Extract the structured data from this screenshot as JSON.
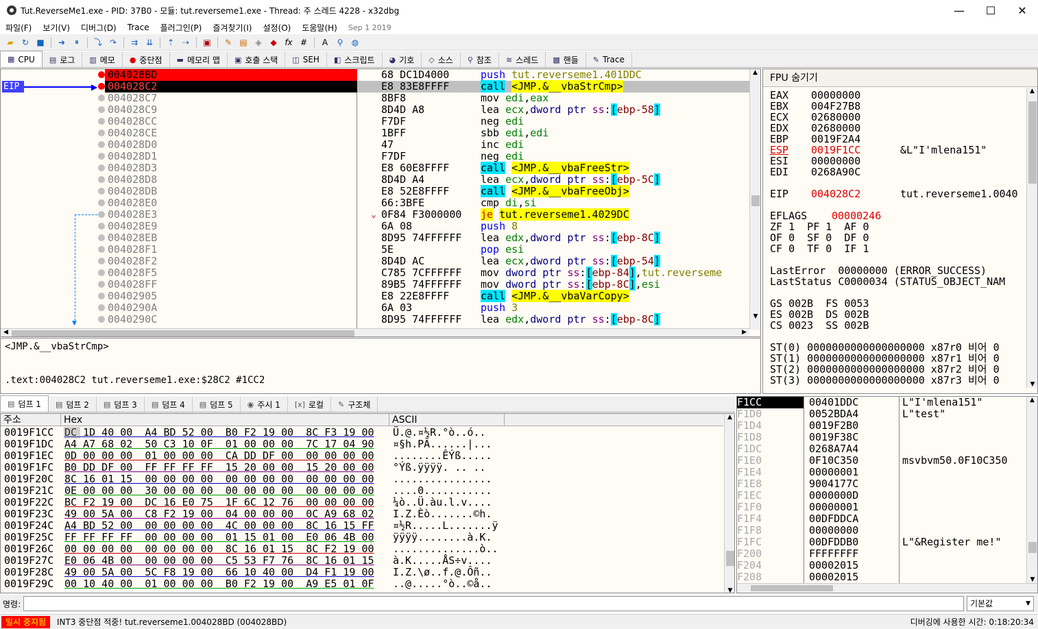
{
  "window": {
    "title": "Tut.ReverseMe1.exe - PID: 37B0 - 모듈: tut.reverseme1.exe - Thread: 주 스레드 4228 - x32dbg",
    "minimize": "—",
    "maximize": "☐",
    "close": "✕"
  },
  "menu": {
    "items": [
      "파일(F)",
      "보기(V)",
      "디버그(D)",
      "Trace",
      "플러그인(P)",
      "즐겨찾기(I)",
      "설정(O)",
      "도움말(H)"
    ],
    "date": "Sep 1 2019"
  },
  "tabs": [
    {
      "label": "CPU",
      "icon": "cpu-icon"
    },
    {
      "label": "로그",
      "icon": "log-icon"
    },
    {
      "label": "메모",
      "icon": "notes-icon"
    },
    {
      "label": "중단점",
      "icon": "breakpoint-icon"
    },
    {
      "label": "메모리 맵",
      "icon": "memory-map-icon"
    },
    {
      "label": "호출 스택",
      "icon": "call-stack-icon"
    },
    {
      "label": "SEH",
      "icon": "seh-icon"
    },
    {
      "label": "스크립트",
      "icon": "script-icon"
    },
    {
      "label": "기호",
      "icon": "symbols-icon"
    },
    {
      "label": "소스",
      "icon": "source-icon"
    },
    {
      "label": "참조",
      "icon": "references-icon"
    },
    {
      "label": "스레드",
      "icon": "threads-icon"
    },
    {
      "label": "핸들",
      "icon": "handles-icon"
    },
    {
      "label": "Trace",
      "icon": "trace-icon"
    }
  ],
  "eip_label": "EIP",
  "disasm": [
    {
      "addr": "004028BD",
      "bytes": "68 DC1D4000",
      "instr": [
        [
          "push",
          "push"
        ],
        [
          " ",
          ""
        ],
        [
          "tut.reverseme1.401DDC",
          "imm"
        ]
      ]
    },
    {
      "addr": "004028C2",
      "bytes": "E8 83E8FFFF",
      "instr": [
        [
          "call",
          "call"
        ],
        [
          " ",
          ""
        ],
        [
          "<JMP.&__vbaStrCmp>",
          "jmp"
        ]
      ]
    },
    {
      "addr": "004028C7",
      "bytes": "8BF8",
      "instr": [
        [
          "mov ",
          ""
        ],
        [
          "edi",
          "reg"
        ],
        [
          ",",
          ""
        ],
        [
          "eax",
          "reg"
        ]
      ]
    },
    {
      "addr": "004028C9",
      "bytes": "8D4D A8",
      "instr": [
        [
          "lea ",
          ""
        ],
        [
          "ecx",
          "reg"
        ],
        [
          ",",
          ""
        ],
        [
          "dword ptr ",
          "ptr"
        ],
        [
          "ss",
          "seg"
        ],
        [
          ":",
          ""
        ],
        [
          "[",
          "brk"
        ],
        [
          "ebp-58",
          "mem"
        ],
        [
          "]",
          "brk"
        ]
      ]
    },
    {
      "addr": "004028CC",
      "bytes": "F7DF",
      "instr": [
        [
          "neg ",
          ""
        ],
        [
          "edi",
          "reg"
        ]
      ]
    },
    {
      "addr": "004028CE",
      "bytes": "1BFF",
      "instr": [
        [
          "sbb ",
          ""
        ],
        [
          "edi",
          "reg"
        ],
        [
          ",",
          ""
        ],
        [
          "edi",
          "reg"
        ]
      ]
    },
    {
      "addr": "004028D0",
      "bytes": "47",
      "instr": [
        [
          "inc ",
          ""
        ],
        [
          "edi",
          "reg"
        ]
      ]
    },
    {
      "addr": "004028D1",
      "bytes": "F7DF",
      "instr": [
        [
          "neg ",
          ""
        ],
        [
          "edi",
          "reg"
        ]
      ]
    },
    {
      "addr": "004028D3",
      "bytes": "E8 60E8FFFF",
      "instr": [
        [
          "call",
          "call"
        ],
        [
          " ",
          ""
        ],
        [
          "<JMP.&__vbaFreeStr>",
          "jmp"
        ]
      ]
    },
    {
      "addr": "004028D8",
      "bytes": "8D4D A4",
      "instr": [
        [
          "lea ",
          ""
        ],
        [
          "ecx",
          "reg"
        ],
        [
          ",",
          ""
        ],
        [
          "dword ptr ",
          "ptr"
        ],
        [
          "ss",
          "seg"
        ],
        [
          ":",
          ""
        ],
        [
          "[",
          "brk"
        ],
        [
          "ebp-5C",
          "mem"
        ],
        [
          "]",
          "brk"
        ]
      ]
    },
    {
      "addr": "004028DB",
      "bytes": "E8 52E8FFFF",
      "instr": [
        [
          "call",
          "call"
        ],
        [
          " ",
          ""
        ],
        [
          "<JMP.&__vbaFreeObj>",
          "jmp"
        ]
      ]
    },
    {
      "addr": "004028E0",
      "bytes": "66:3BFE",
      "instr": [
        [
          "cmp ",
          ""
        ],
        [
          "di",
          "reg"
        ],
        [
          ",",
          ""
        ],
        [
          "si",
          "reg"
        ]
      ]
    },
    {
      "addr": "004028E3",
      "bytes": "0F84 F3000000",
      "instr": [
        [
          "je",
          "je"
        ],
        [
          " ",
          ""
        ],
        [
          "tut.reverseme1.4029DC",
          "jmp"
        ]
      ]
    },
    {
      "addr": "004028E9",
      "bytes": "6A 08",
      "instr": [
        [
          "push",
          "push"
        ],
        [
          " ",
          ""
        ],
        [
          "8",
          "imm"
        ]
      ]
    },
    {
      "addr": "004028EB",
      "bytes": "8D95 74FFFFFF",
      "instr": [
        [
          "lea ",
          ""
        ],
        [
          "edx",
          "reg"
        ],
        [
          ",",
          ""
        ],
        [
          "dword ptr ",
          "ptr"
        ],
        [
          "ss",
          "seg"
        ],
        [
          ":",
          ""
        ],
        [
          "[",
          "brk"
        ],
        [
          "ebp-8C",
          "mem"
        ],
        [
          "]",
          "brk"
        ]
      ]
    },
    {
      "addr": "004028F1",
      "bytes": "5E",
      "instr": [
        [
          "pop ",
          "push"
        ],
        [
          "esi",
          "reg"
        ]
      ]
    },
    {
      "addr": "004028F2",
      "bytes": "8D4D AC",
      "instr": [
        [
          "lea ",
          ""
        ],
        [
          "ecx",
          "reg"
        ],
        [
          ",",
          ""
        ],
        [
          "dword ptr ",
          "ptr"
        ],
        [
          "ss",
          "seg"
        ],
        [
          ":",
          ""
        ],
        [
          "[",
          "brk"
        ],
        [
          "ebp-54",
          "mem"
        ],
        [
          "]",
          "brk"
        ]
      ]
    },
    {
      "addr": "004028F5",
      "bytes": "C785 7CFFFFFF",
      "instr": [
        [
          "mov ",
          ""
        ],
        [
          "dword ptr ",
          "ptr"
        ],
        [
          "ss",
          "seg"
        ],
        [
          ":",
          ""
        ],
        [
          "[",
          "brk"
        ],
        [
          "ebp-84",
          "mem"
        ],
        [
          "]",
          "brk"
        ],
        [
          ",",
          ""
        ],
        [
          "tut.reverseme",
          "imm"
        ]
      ]
    },
    {
      "addr": "004028FF",
      "bytes": "89B5 74FFFFFF",
      "instr": [
        [
          "mov ",
          ""
        ],
        [
          "dword ptr ",
          "ptr"
        ],
        [
          "ss",
          "seg"
        ],
        [
          ":",
          ""
        ],
        [
          "[",
          "brk"
        ],
        [
          "ebp-8C",
          "mem"
        ],
        [
          "]",
          "brk"
        ],
        [
          ",",
          ""
        ],
        [
          "esi",
          "reg"
        ]
      ]
    },
    {
      "addr": "00402905",
      "bytes": "E8 22E8FFFF",
      "instr": [
        [
          "call",
          "call"
        ],
        [
          " ",
          ""
        ],
        [
          "<JMP.&__vbaVarCopy>",
          "jmp"
        ]
      ]
    },
    {
      "addr": "0040290A",
      "bytes": "6A 03",
      "instr": [
        [
          "push",
          "push"
        ],
        [
          " ",
          ""
        ],
        [
          "3",
          "imm"
        ]
      ]
    },
    {
      "addr": "0040290C",
      "bytes": "8D95 74FFFFFF",
      "instr": [
        [
          "lea ",
          ""
        ],
        [
          "edx",
          "reg"
        ],
        [
          ",",
          ""
        ],
        [
          "dword ptr ",
          "ptr"
        ],
        [
          "ss",
          "seg"
        ],
        [
          ":",
          ""
        ],
        [
          "[",
          "brk"
        ],
        [
          "ebp-8C",
          "mem"
        ],
        [
          "]",
          "brk"
        ]
      ]
    }
  ],
  "info": {
    "line1": "<JMP.&__vbaStrCmp>",
    "line2": ".text:004028C2 tut.reverseme1.exe:$28C2 #1CC2"
  },
  "regs": {
    "header": "FPU 숨기기",
    "gp": [
      {
        "name": "EAX",
        "value": "00000000",
        "comment": ""
      },
      {
        "name": "EBX",
        "value": "004F27B8",
        "comment": ""
      },
      {
        "name": "ECX",
        "value": "02680000",
        "comment": ""
      },
      {
        "name": "EDX",
        "value": "02680000",
        "comment": ""
      },
      {
        "name": "EBP",
        "value": "0019F2A4",
        "comment": ""
      },
      {
        "name": "ESP",
        "value": "0019F1CC",
        "comment": "&L\"I'mlena151\""
      },
      {
        "name": "ESI",
        "value": "00000000",
        "comment": ""
      },
      {
        "name": "EDI",
        "value": "0268A90C",
        "comment": ""
      }
    ],
    "eip": {
      "name": "EIP",
      "value": "004028C2",
      "comment": "tut.reverseme1.0040"
    },
    "eflags": {
      "name": "EFLAGS",
      "value": "00000246"
    },
    "flags": [
      "ZF 1  PF 1  AF 0",
      "OF 0  SF 0  DF 0",
      "CF 0  TF 0  IF 1"
    ],
    "lasterror": "LastError  00000000 (ERROR_SUCCESS)",
    "laststatus": "LastStatus C0000034 (STATUS_OBJECT_NAM",
    "segs": [
      "GS 002B  FS 0053",
      "ES 002B  DS 002B",
      "CS 0023  SS 002B"
    ],
    "fpu": [
      "ST(0) 0000000000000000000 x87r0 비어 0",
      "ST(1) 0000000000000000000 x87r1 비어 0",
      "ST(2) 0000000000000000000 x87r2 비어 0",
      "ST(3) 0000000000000000000 x87r3 비어 0"
    ]
  },
  "dump_tabs": [
    {
      "label": "덤프 1",
      "icon": "dump-icon"
    },
    {
      "label": "덤프 2",
      "icon": "dump-icon"
    },
    {
      "label": "덤프 3",
      "icon": "dump-icon"
    },
    {
      "label": "덤프 4",
      "icon": "dump-icon"
    },
    {
      "label": "덤프 5",
      "icon": "dump-icon"
    },
    {
      "label": "주시 1",
      "icon": "watch-icon"
    },
    {
      "label": "로컬",
      "icon": "locals-icon"
    },
    {
      "label": "구조체",
      "icon": "struct-icon"
    }
  ],
  "dump_headers": {
    "addr": "주소",
    "hex": "Hex",
    "ascii": "ASCII"
  },
  "dump": [
    {
      "a": "0019F1CC",
      "h": "DC 1D 40 00  A4 BD 52 00  B0 F2 19 00  8C F3 19 00",
      "x": "Ü.@.¤½R.°ò..ó.."
    },
    {
      "a": "0019F1DC",
      "h": "A4 A7 68 02  50 C3 10 0F  01 00 00 00  7C 17 04 90",
      "x": "¤§h.PÃ......|..."
    },
    {
      "a": "0019F1EC",
      "h": "0D 00 00 00  01 00 00 00  CA DD DF 00  00 00 00 00",
      "x": "........ÊÝß....."
    },
    {
      "a": "0019F1FC",
      "h": "B0 DD DF 00  FF FF FF FF  15 20 00 00  15 20 00 00",
      "x": "°Ýß.ÿÿÿÿ. .. .."
    },
    {
      "a": "0019F20C",
      "h": "8C 16 01 15  00 00 00 00  00 00 00 00  00 00 00 00",
      "x": "................"
    },
    {
      "a": "0019F21C",
      "h": "0E 00 00 00  30 00 00 00  00 00 00 00  00 00 00 00",
      "x": "....0..........."
    },
    {
      "a": "0019F22C",
      "h": "BC F2 19 00  DC 16 E0 75  1F 6C 12 76  00 00 00 00",
      "x": "¼ò..Ü.àu.l.v...."
    },
    {
      "a": "0019F23C",
      "h": "49 00 5A 00  C8 F2 19 00  04 00 00 00  0C A9 68 02",
      "x": "I.Z.Èò.......©h."
    },
    {
      "a": "0019F24C",
      "h": "A4 BD 52 00  00 00 00 00  4C 00 00 00  8C 16 15 FF",
      "x": "¤½R.....L.......ÿ"
    },
    {
      "a": "0019F25C",
      "h": "FF FF FF FF  00 00 00 00  01 15 01 00  E0 06 4B 00",
      "x": "ÿÿÿÿ........à.K."
    },
    {
      "a": "0019F26C",
      "h": "00 00 00 00  00 00 00 00  8C 16 01 15  8C F2 19 00",
      "x": "..............ò.."
    },
    {
      "a": "0019F27C",
      "h": "E0 06 4B 00  00 00 00 00  C5 53 F7 76  8C 16 01 15",
      "x": "à.K.....ÅS÷v...."
    },
    {
      "a": "0019F28C",
      "h": "49 00 5A 00  5C F8 19 00  66 10 40 00  D4 F1 19 00",
      "x": "I.Z.\\ø..f.@.Ôñ.."
    },
    {
      "a": "0019F29C",
      "h": "00 10 40 00  01 00 00 00  B0 F2 19 00  A9 E5 01 0F",
      "x": "..@.....°ò..©å.."
    }
  ],
  "stack": [
    {
      "a": "0019F1CC",
      "v": "00401DDC",
      "c": "L\"I'mlena151\""
    },
    {
      "a": "0019F1D0",
      "v": "0052BDA4",
      "c": "L\"test\""
    },
    {
      "a": "0019F1D4",
      "v": "0019F2B0",
      "c": ""
    },
    {
      "a": "0019F1D8",
      "v": "0019F38C",
      "c": ""
    },
    {
      "a": "0019F1DC",
      "v": "0268A7A4",
      "c": ""
    },
    {
      "a": "0019F1E0",
      "v": "0F10C350",
      "c": "msvbvm50.0F10C350"
    },
    {
      "a": "0019F1E4",
      "v": "00000001",
      "c": ""
    },
    {
      "a": "0019F1E8",
      "v": "9004177C",
      "c": ""
    },
    {
      "a": "0019F1EC",
      "v": "0000000D",
      "c": ""
    },
    {
      "a": "0019F1F0",
      "v": "00000001",
      "c": ""
    },
    {
      "a": "0019F1F4",
      "v": "00DFDDCA",
      "c": ""
    },
    {
      "a": "0019F1F8",
      "v": "00000000",
      "c": ""
    },
    {
      "a": "0019F1FC",
      "v": "00DFDDB0",
      "c": "L\"&Register me!\""
    },
    {
      "a": "0019F200",
      "v": "FFFFFFFF",
      "c": ""
    },
    {
      "a": "0019F204",
      "v": "00002015",
      "c": ""
    },
    {
      "a": "0019F208",
      "v": "00002015",
      "c": ""
    }
  ],
  "cmd": {
    "label": "명령:",
    "default": "기본값"
  },
  "status": {
    "paused": "일시 중지됨",
    "message": "INT3 중단점 적중! tut.reverseme1.004028BD (004028BD)",
    "time": "디버깅에 사용한 시간: 0:18:20:34"
  },
  "colors": {
    "eip_row": "#000000",
    "bp_row": "#ff0000",
    "call": "#00e5ff",
    "jmp": "#ffff00",
    "bg": "#fffbf5"
  }
}
